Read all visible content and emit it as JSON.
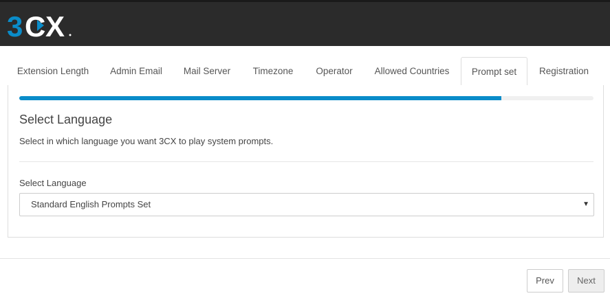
{
  "header": {
    "logo_text": "3CX",
    "colors": {
      "background": "#2b2b2b",
      "logo_accent": "#0a8cc9",
      "logo_white": "#ffffff"
    }
  },
  "tabs": [
    {
      "label": "Extension Length",
      "active": false
    },
    {
      "label": "Admin Email",
      "active": false
    },
    {
      "label": "Mail Server",
      "active": false
    },
    {
      "label": "Timezone",
      "active": false
    },
    {
      "label": "Operator",
      "active": false
    },
    {
      "label": "Allowed Countries",
      "active": false
    },
    {
      "label": "Prompt set",
      "active": true
    },
    {
      "label": "Registration",
      "active": false
    }
  ],
  "wizard": {
    "progress_fraction": 0.84,
    "progress_color": "#0a8cc9"
  },
  "section": {
    "title": "Select Language",
    "description": "Select in which language you want 3CX to play system prompts."
  },
  "language_field": {
    "label": "Select Language",
    "selected_value": "Standard English Prompts Set",
    "caret_icon": "caret-down-icon"
  },
  "footer": {
    "prev_label": "Prev",
    "next_label": "Next"
  }
}
